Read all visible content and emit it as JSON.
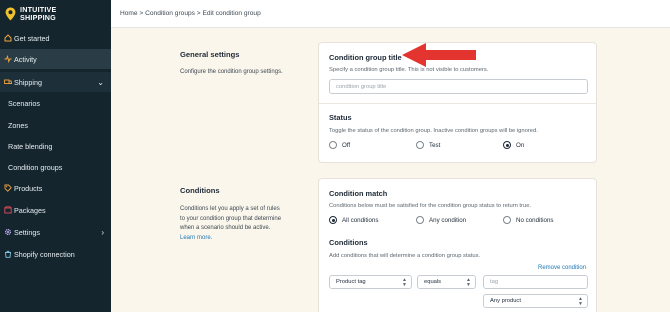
{
  "brand": {
    "line1": "INTUITIVE",
    "line2": "SHIPPING"
  },
  "sidebar": {
    "items": [
      {
        "label": "Get started",
        "icon": "home-icon"
      },
      {
        "label": "Activity",
        "icon": "activity-icon"
      },
      {
        "label": "Shipping",
        "icon": "truck-icon",
        "chevron": "⌄"
      },
      {
        "label": "Scenarios"
      },
      {
        "label": "Zones"
      },
      {
        "label": "Rate blending"
      },
      {
        "label": "Condition groups"
      },
      {
        "label": "Products",
        "icon": "tag-icon"
      },
      {
        "label": "Packages",
        "icon": "box-icon"
      },
      {
        "label": "Settings",
        "icon": "gear-icon",
        "chevron": "›"
      },
      {
        "label": "Shopify connection",
        "icon": "shopify-icon"
      }
    ]
  },
  "breadcrumb": "Home > Condition groups > Edit condition group",
  "general": {
    "title": "General settings",
    "desc": "Configure the condition group settings.",
    "title_heading": "Condition group title",
    "title_help": "Specify a condition group title. This is not visible to customers.",
    "title_placeholder": "condition group title",
    "status_heading": "Status",
    "status_help": "Toggle the status of the condition group. Inactive condition groups will be ignored.",
    "status_options": [
      "Off",
      "Test",
      "On"
    ],
    "status_selected": "On"
  },
  "conditions": {
    "title": "Conditions",
    "desc_line1": "Conditions let you apply a set of rules",
    "desc_line2": "to your condition group that determine",
    "desc_line3": "when a scenario should be active.",
    "learn_more": "Learn more.",
    "match_heading": "Condition match",
    "match_help": "Conditions below must be satisfied for the condition group status to return true.",
    "match_options": [
      "All conditions",
      "Any condition",
      "No conditions"
    ],
    "match_selected": "All conditions",
    "list_heading": "Conditions",
    "list_help": "Add conditions that will determine a condition group status.",
    "remove_label": "Remove condition",
    "row": {
      "field": "Product tag",
      "operator": "equals",
      "value_placeholder": "tag",
      "scope": "Any product"
    }
  },
  "colors": {
    "sidebar": "#14252e",
    "accent": "#1f78b4",
    "arrow": "#e3342f",
    "background": "#fbf6ec"
  }
}
